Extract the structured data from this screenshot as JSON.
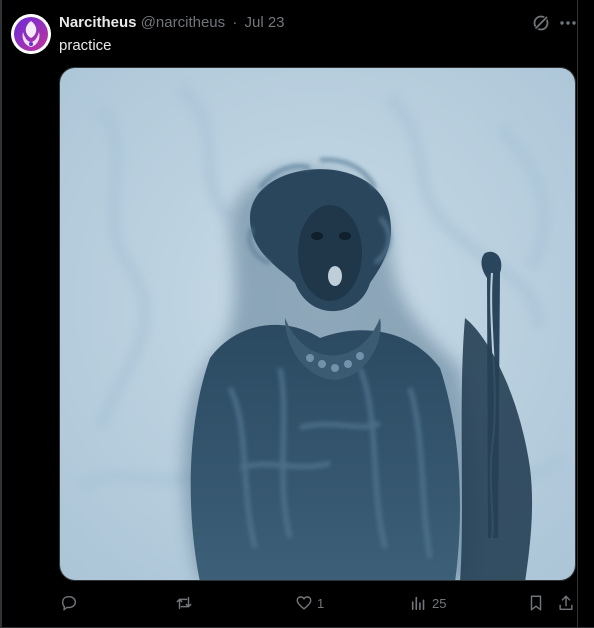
{
  "tweet": {
    "author_name": "Narcitheus",
    "handle": "@narcitheus",
    "separator": "·",
    "date": "Jul 23",
    "text": "practice",
    "avatar_colors": [
      "#6a2bd9",
      "#c0359b",
      "#ffffff"
    ]
  },
  "media": {
    "description_icon": "painting-image",
    "palette": {
      "background": "#bcd3e2",
      "figure_dark": "#1f3648",
      "figure_mid": "#3f6079",
      "highlight": "#8fb0c6"
    }
  },
  "actions": {
    "reply": {
      "icon": "reply-icon",
      "count": ""
    },
    "retweet": {
      "icon": "retweet-icon",
      "count": ""
    },
    "like": {
      "icon": "heart-icon",
      "count": "1"
    },
    "views": {
      "icon": "views-icon",
      "count": "25"
    },
    "bookmark": {
      "icon": "bookmark-icon"
    },
    "share": {
      "icon": "share-icon"
    }
  }
}
